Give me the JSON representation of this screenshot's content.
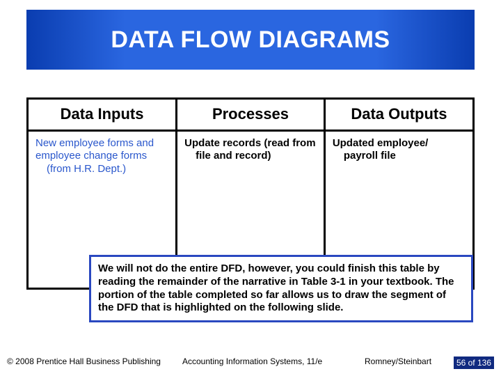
{
  "title": "DATA FLOW DIAGRAMS",
  "table": {
    "headers": [
      "Data Inputs",
      "Processes",
      "Data Outputs"
    ],
    "row": {
      "inputs_main": "New employee forms and employee change forms",
      "inputs_sub": "(from H.R. Dept.)",
      "processes_main": "Update records (read from",
      "processes_sub": "file and record)",
      "outputs_main": "Updated employee/",
      "outputs_sub": "payroll file"
    }
  },
  "callout": "We will not do the entire DFD, however, you could finish this table by reading the remainder of the narrative in Table 3-1 in your textbook. The portion of the table completed so far allows us to draw the segment of the DFD that is highlighted on the following slide.",
  "footer": {
    "copyright": "© 2008 Prentice Hall Business Publishing",
    "book": "Accounting Information Systems, 11/e",
    "authors": "Romney/Steinbart",
    "page": "56 of 136"
  }
}
